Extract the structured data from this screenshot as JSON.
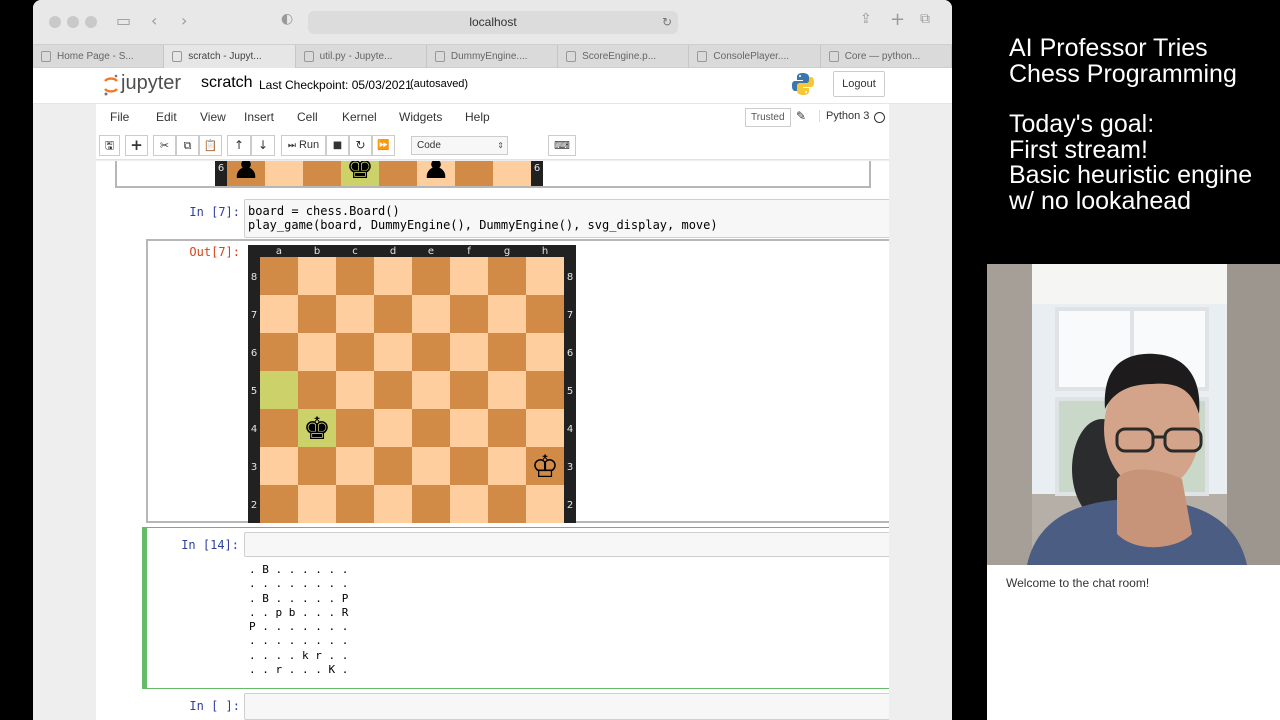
{
  "browser": {
    "url": "localhost",
    "tabs": [
      "Home Page - S...",
      "scratch - Jupyt...",
      "util.py - Jupyte...",
      "DummyEngine....",
      "ScoreEngine.p...",
      "ConsolePlayer....",
      "Core — python..."
    ],
    "active_tab": 1
  },
  "jupyter": {
    "logo_text": "jupyter",
    "notebook_name": "scratch",
    "checkpoint": "Last Checkpoint: 05/03/2021",
    "autosave_status": "(autosaved)",
    "logout_label": "Logout",
    "menu": [
      "File",
      "Edit",
      "View",
      "Insert",
      "Cell",
      "Kernel",
      "Widgets",
      "Help"
    ],
    "trusted_label": "Trusted",
    "kernel_name": "Python 3",
    "run_label": "Run",
    "cell_type": "Code"
  },
  "cells": {
    "partial_board": {
      "rank_label": "6",
      "pieces": [
        {
          "square": "a6",
          "glyph": "♟"
        },
        {
          "square": "d6",
          "glyph": "♚"
        },
        {
          "square": "f6",
          "glyph": "♟"
        }
      ],
      "highlight": "d6"
    },
    "cell7": {
      "prompt": "In [7]:",
      "code_line1": "board = chess.Board()",
      "code_line2": "play_game(board, DummyEngine(), DummyEngine(), svg_display, move)",
      "out_prompt": "Out[7]:"
    },
    "board": {
      "files": [
        "a",
        "b",
        "c",
        "d",
        "e",
        "f",
        "g",
        "h"
      ],
      "ranks": [
        "8",
        "7",
        "6",
        "5",
        "4",
        "3",
        "2"
      ],
      "pieces": [
        {
          "square": "b4",
          "glyph": "♚"
        },
        {
          "square": "h3",
          "glyph": "♔"
        }
      ],
      "highlights": [
        "a5",
        "b4"
      ],
      "light_color": "#ffce9e",
      "dark_color": "#d18b47",
      "highlight_light": "#cdd16a",
      "highlight_dark": "#aaa23b"
    },
    "cell14": {
      "prompt": "In [14]:",
      "output": ". B . . . . . .\n. . . . . . . .\n. B . . . . . P\n. . p b . . . R\nP . . . . . . .\n. . . . . . . .\n. . . . k r . .\n. . r . . . K ."
    },
    "cell_empty": {
      "prompt": "In [ ]:"
    }
  },
  "stream": {
    "title": "AI Professor Tries\nChess Programming",
    "goal": "Today's goal:\nFirst stream!\nBasic heuristic engine\nw/ no lookahead",
    "chat_welcome": "Welcome to the chat room!"
  }
}
